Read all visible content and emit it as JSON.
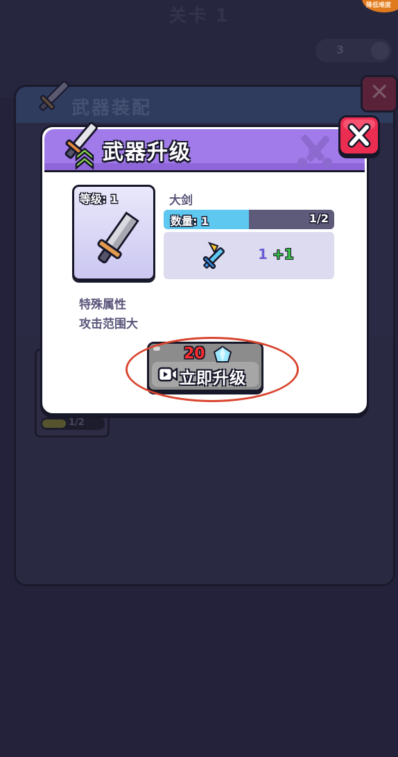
{
  "background": {
    "level_title": "关卡 1",
    "corner_badge": "降低难度",
    "counter_value": "3",
    "panel_title": "武器装配",
    "card_progress": "1/2"
  },
  "dialog": {
    "title": "武器升级",
    "item": {
      "level_label": "等级: 1",
      "name": "大剑",
      "quantity_label": "数量: 1",
      "quantity_count": "1/2",
      "quantity_fraction": 0.5,
      "stat_value": "1",
      "stat_bonus": "+1"
    },
    "special_attribute_title": "特殊属性",
    "special_attribute_value": "攻击范围大",
    "upgrade_button": {
      "cost": "20",
      "label": "立即升级",
      "cost_icon": "diamond-icon",
      "prefix_icon": "video-icon"
    }
  },
  "colors": {
    "header_purple": "#a27bea",
    "close_red": "#ec2d52",
    "quantity_fill": "#5ec8f0",
    "bonus_green": "#3cc24a",
    "highlight_circle": "#d9452f"
  }
}
